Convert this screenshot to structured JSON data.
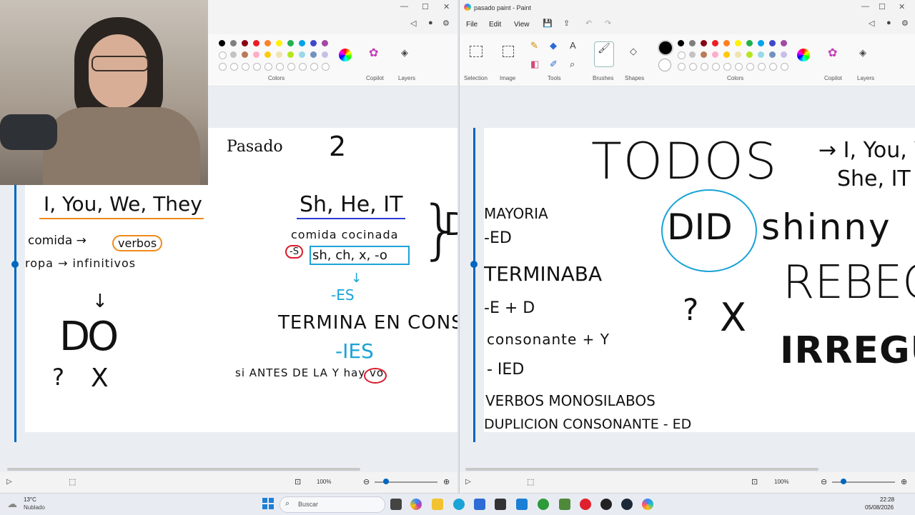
{
  "left_window": {
    "title": "",
    "ribbon": {
      "colors_label": "Colors",
      "copilot_label": "Copilot",
      "layers_label": "Layers"
    },
    "status": {
      "zoom": "100%"
    },
    "notes": {
      "heading": "Pasado",
      "number": "2",
      "pronouns_1": "I, You, We, They",
      "line_comida": "comida →",
      "verbos": "verbos",
      "line_infinitivos": "ropa → infinitivos",
      "do": "DO",
      "question": "?",
      "x_mark": "X",
      "pronouns_2": "Sh, He, IT",
      "line_cocinada": "comida cocinada",
      "s_mark": "-S",
      "endings": "sh, ch, x, -o",
      "es": "-ES",
      "termina": "TERMINA EN CONS",
      "ies": "-IES",
      "si_antes": "si ANTES DE LA Y hay vo",
      "y_mark": "Y",
      "brace_letter": "D"
    }
  },
  "right_window": {
    "title": "pasado paint - Paint",
    "menu": [
      "File",
      "Edit",
      "View"
    ],
    "ribbon": {
      "selection": "Selection",
      "image": "Image",
      "tools": "Tools",
      "brushes": "Brushes",
      "shapes": "Shapes",
      "colors": "Colors",
      "copilot": "Copilot",
      "layers": "Layers"
    },
    "status": {
      "zoom": "100%"
    },
    "notes": {
      "todos": "TODOS",
      "arrow_text": "→ I, You, W",
      "she_it": "She, IT",
      "mayoria": "MAYORIA",
      "ed": "-ED",
      "terminaba": "TERMINABA",
      "e_d": "-E + D",
      "consonante": "consonante + Y",
      "ied": "- IED",
      "verbos_mono": "VERBOS MONOSILABOS",
      "duplicion": "DUPLICION CONSONANTE - ED",
      "did": "DID",
      "shinny": "shinny",
      "rebecca": "REBEC",
      "question": "?",
      "x_mark": "X",
      "irregular": "IRREGULA"
    }
  },
  "taskbar": {
    "weather_temp": "13°C",
    "weather_desc": "Nublado",
    "search_placeholder": "Buscar",
    "time": "22:28",
    "date": "05/08/2026"
  },
  "colors": {
    "accent": "#0067c0",
    "cyan_ink": "#1aa3d6",
    "orange_ink": "#f08a1c",
    "red_ink": "#d81b2c",
    "blue_ink": "#2d3ad6"
  }
}
